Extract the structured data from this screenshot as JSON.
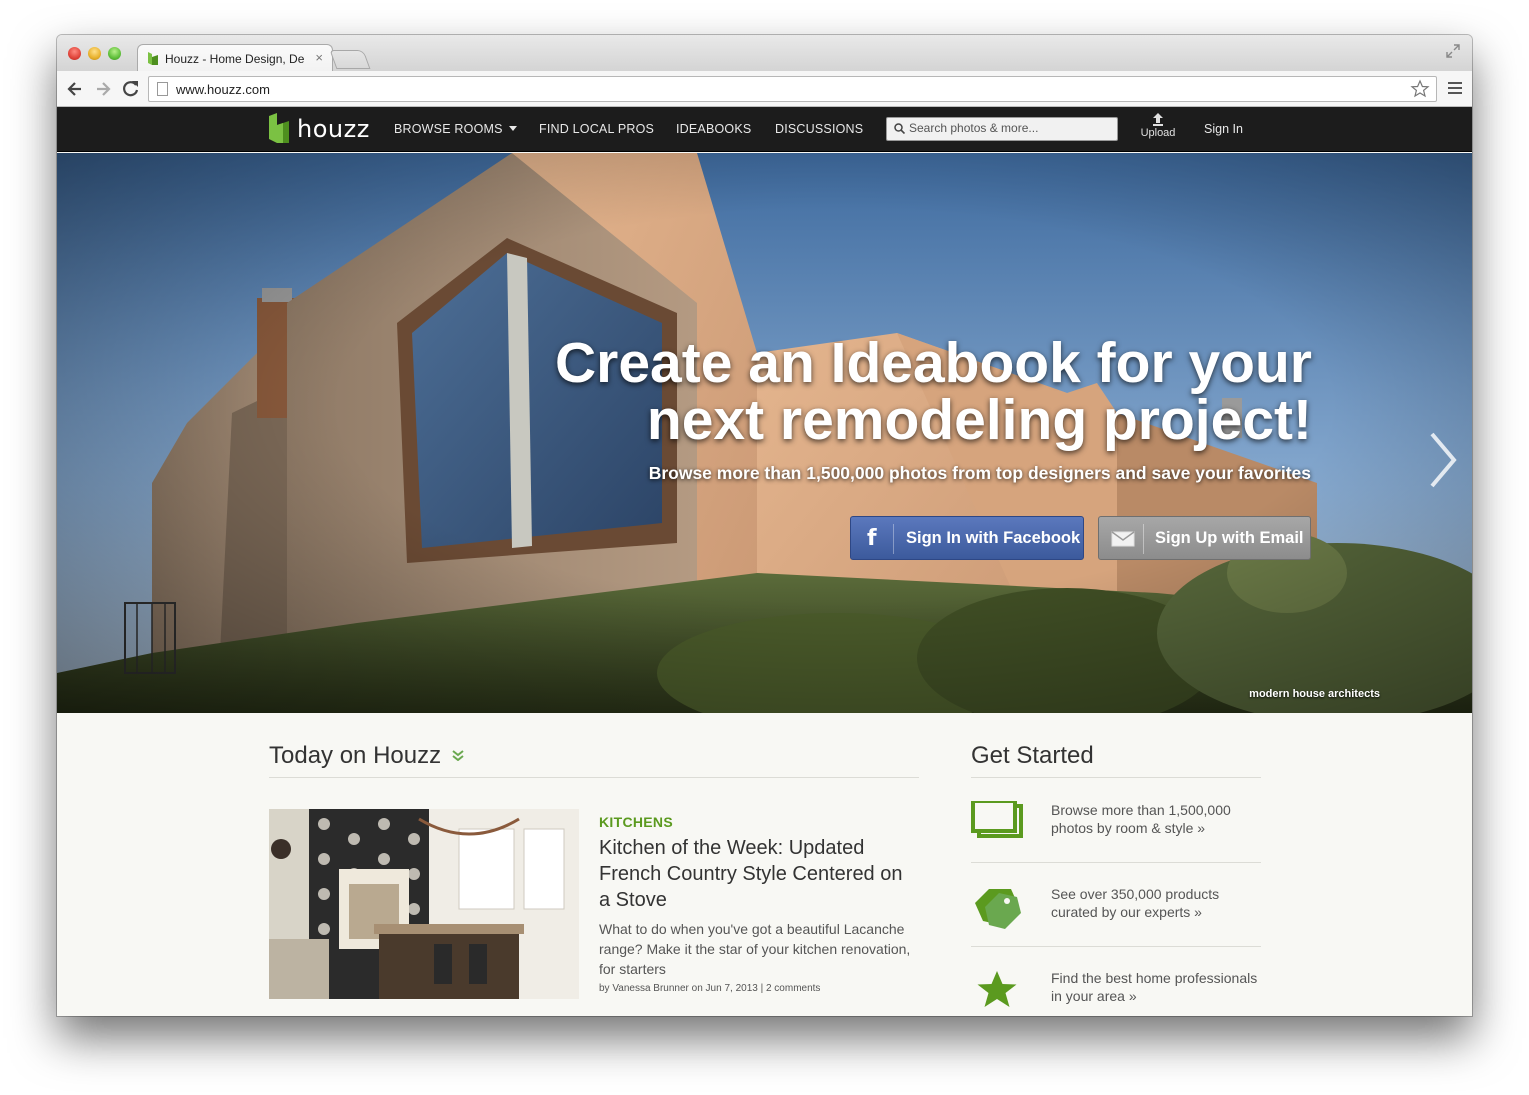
{
  "browser": {
    "tab_title": "Houzz - Home Design, De",
    "tab_close": "×",
    "url": "www.houzz.com"
  },
  "header": {
    "logo_text": "houzz",
    "nav": {
      "browse_rooms": "BROWSE ROOMS",
      "find_local_pros": "FIND LOCAL PROS",
      "ideabooks": "IDEABOOKS",
      "discussions": "DISCUSSIONS"
    },
    "search_placeholder": "Search photos & more...",
    "upload_label": "Upload",
    "signin_label": "Sign In"
  },
  "hero": {
    "title_line1": "Create an Ideabook for your",
    "title_line2": "next remodeling project!",
    "subtitle": "Browse more than 1,500,000 photos from top designers and save your favorites",
    "facebook_button": "Sign In with Facebook",
    "email_button": "Sign Up with Email",
    "photo_credit": "modern house architects"
  },
  "today": {
    "heading": "Today on Houzz",
    "article": {
      "category": "KITCHENS",
      "title": "Kitchen of the Week: Updated French Country Style Centered on a Stove",
      "description": "What to do when you've got a beautiful Lacanche range? Make it the star of your kitchen renovation, for starters",
      "byline": "by Vanessa Brunner on Jun 7, 2013 | 2 comments"
    }
  },
  "get_started": {
    "heading": "Get Started",
    "items": [
      {
        "icon": "photos-icon",
        "text": "Browse more than 1,500,000 photos by room & style »"
      },
      {
        "icon": "tags-icon",
        "text": "See over 350,000 products curated by our experts »"
      },
      {
        "icon": "star-icon",
        "text": "Find the best home professionals in your area »"
      }
    ]
  },
  "colors": {
    "brand_green": "#5b9a1f",
    "header_bg": "#1c1c1c",
    "facebook_blue": "#3c5a9c"
  }
}
